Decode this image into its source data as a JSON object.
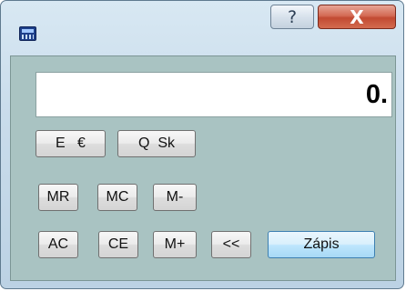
{
  "window": {
    "title_buttons": {
      "help_label": "?",
      "close_label": "X"
    }
  },
  "display": {
    "value": "0."
  },
  "buttons": {
    "row1": [
      "E   €",
      "Q  Sk"
    ],
    "row2": [
      "MR",
      "MC",
      "M-"
    ],
    "row3": [
      "AC",
      "CE",
      "M+",
      "<<",
      "Zápis"
    ]
  },
  "icons": {
    "app": "calculator-icon"
  }
}
